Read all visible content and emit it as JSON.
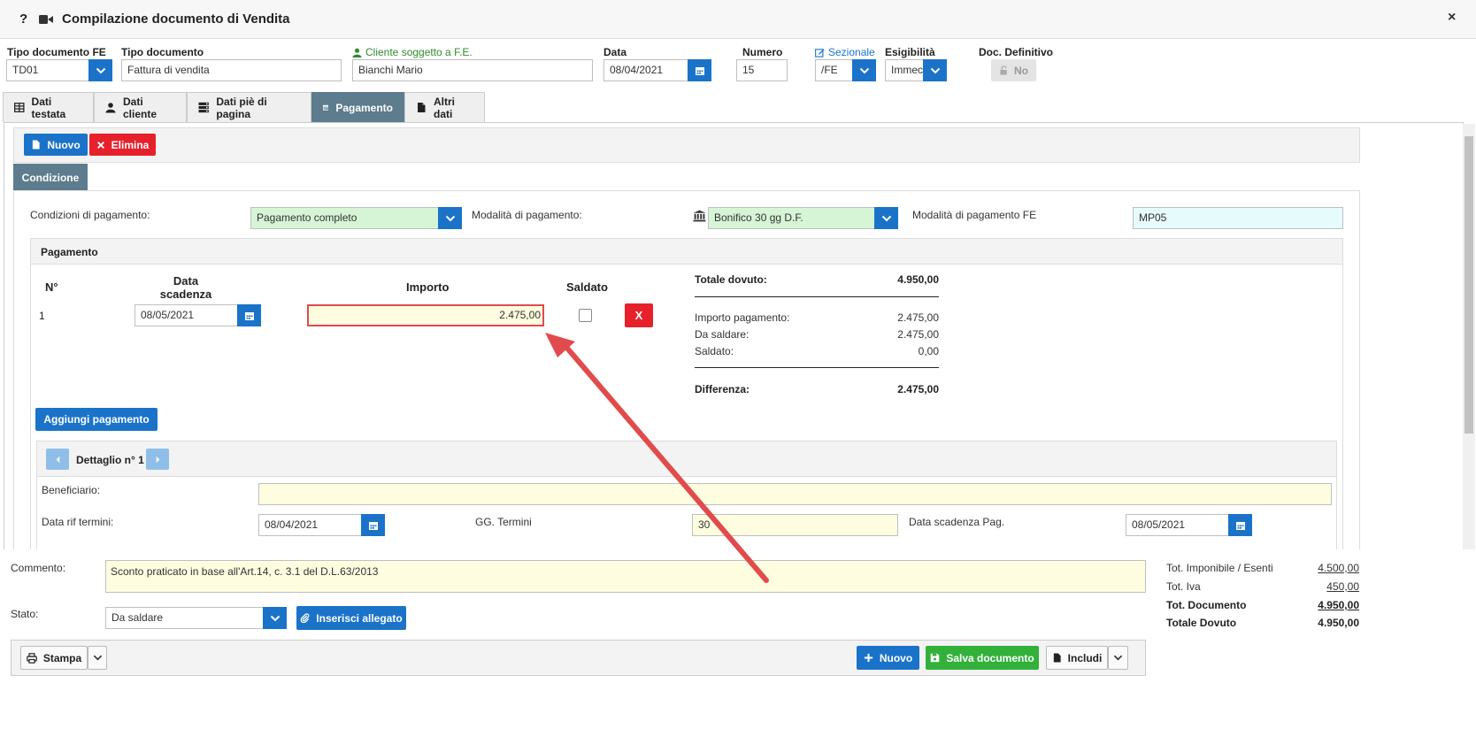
{
  "window": {
    "title": "Compilazione documento di Vendita",
    "help": "?",
    "close": "×"
  },
  "header": {
    "tipo_fe": {
      "label": "Tipo documento FE",
      "value": "TD01"
    },
    "tipo_doc": {
      "label": "Tipo documento",
      "value": "Fattura di vendita"
    },
    "cliente": {
      "label": "Cliente soggetto a F.E.",
      "value": "Bianchi Mario"
    },
    "data": {
      "label": "Data",
      "value": "08/04/2021"
    },
    "numero": {
      "label": "Numero",
      "value": "15"
    },
    "sezionale": {
      "label": "Sezionale",
      "value": "/FE"
    },
    "esigibilita": {
      "label": "Esigibilità",
      "value": "Immec"
    },
    "definitivo": {
      "label": "Doc. Definitivo",
      "value": "No"
    }
  },
  "tabs": [
    {
      "label": "Dati testata"
    },
    {
      "label": "Dati cliente"
    },
    {
      "label": "Dati piè di pagina"
    },
    {
      "label": "Pagamento"
    },
    {
      "label": "Altri dati"
    }
  ],
  "toolbar": {
    "nuovo": "Nuovo",
    "elimina": "Elimina"
  },
  "condizione": {
    "tab": "Condizione",
    "cond_label": "Condizioni di pagamento:",
    "cond_value": "Pagamento completo",
    "mod_label": "Modalità di pagamento:",
    "mod_value": "Bonifico 30 gg D.F.",
    "modfe_label": "Modalità di pagamento FE",
    "modfe_value": "MP05"
  },
  "pagamento": {
    "title": "Pagamento",
    "col_n": "N°",
    "col_data_1": "Data",
    "col_data_2": "scadenza",
    "col_importo": "Importo",
    "col_saldato": "Saldato",
    "row": {
      "n": "1",
      "data": "08/05/2021",
      "importo": "2.475,00",
      "delete": "X"
    },
    "summary": {
      "totale_dovuto_label": "Totale dovuto:",
      "totale_dovuto_value": "4.950,00",
      "importo_pag_label": "Importo pagamento:",
      "importo_pag_value": "2.475,00",
      "da_saldare_label": "Da saldare:",
      "da_saldare_value": "2.475,00",
      "saldato_label": "Saldato:",
      "saldato_value": "0,00",
      "differenza_label": "Differenza:",
      "differenza_value": "2.475,00"
    },
    "aggiungi": "Aggiungi pagamento"
  },
  "dettaglio": {
    "title": "Dettaglio n° 1",
    "beneficiario_label": "Beneficiario:",
    "beneficiario_value": "",
    "data_rif_label": "Data rif termini:",
    "data_rif_value": "08/04/2021",
    "gg_label": "GG. Termini",
    "gg_value": "30",
    "scad_label": "Data scadenza Pag.",
    "scad_value": "08/05/2021"
  },
  "footer": {
    "commento_label": "Commento:",
    "commento_value": "Sconto praticato in base all'Art.14, c. 3.1 del D.L.63/2013",
    "stato_label": "Stato:",
    "stato_value": "Da saldare",
    "inserisci_allegato": "Inserisci allegato",
    "totals": {
      "imponibile_label": "Tot. Imponibile / Esenti",
      "imponibile_value": "4.500,00",
      "iva_label": "Tot. Iva",
      "iva_value": "450,00",
      "documento_label": "Tot. Documento",
      "documento_value": "4.950,00",
      "dovuto_label": "Totale Dovuto",
      "dovuto_value": "4.950,00"
    },
    "stampa": "Stampa",
    "nuovo": "Nuovo",
    "salva": "Salva documento",
    "includi": "Includi"
  },
  "colors": {
    "primary": "#1a73c8",
    "danger": "#e6212b",
    "success": "#32b13a",
    "tab_active": "#5d7c8d",
    "green_field": "#d6f5d6",
    "yellow_field": "#fefde0",
    "cyan_field": "#e6fbfc",
    "arrow": "#e24b4b"
  }
}
